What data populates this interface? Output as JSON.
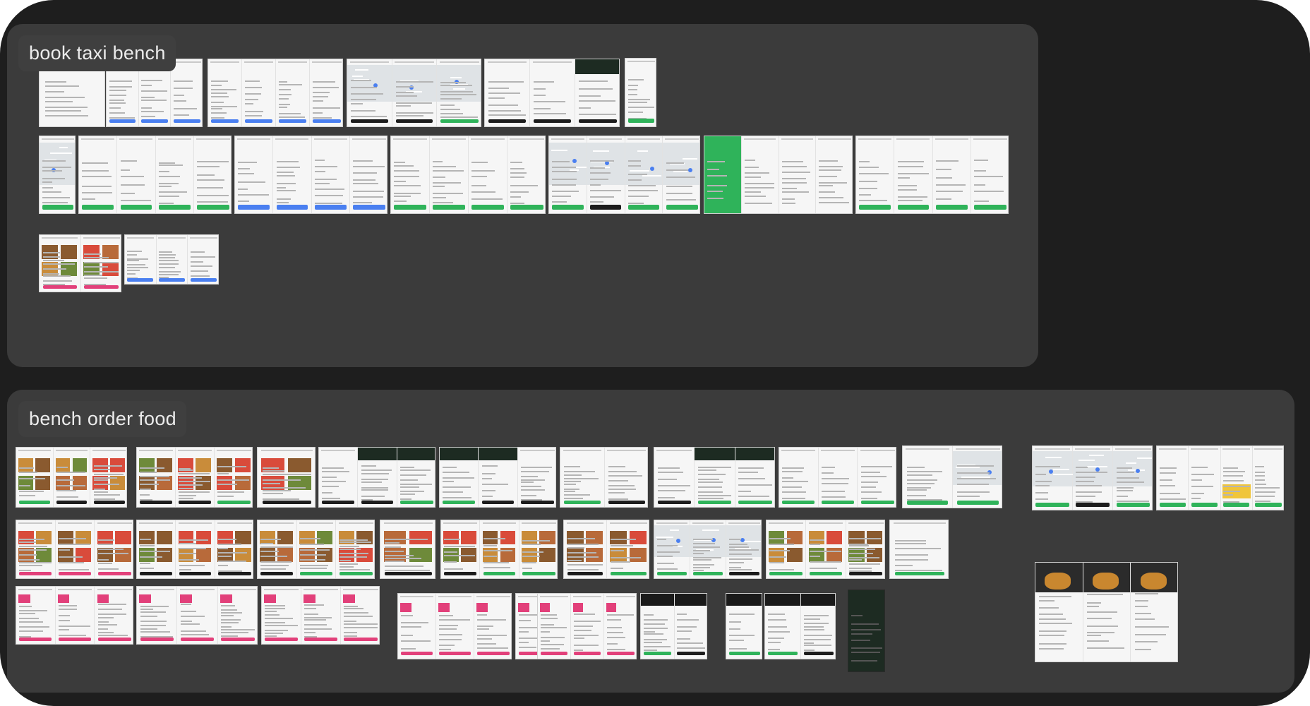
{
  "canvas": {
    "background": "#1e1e1e",
    "section_color": "#3b3b3b"
  },
  "sections": [
    {
      "id": "taxi",
      "label": "book taxi bench"
    },
    {
      "id": "food",
      "label": "bench order food"
    }
  ],
  "accent_colors": {
    "taxi_green": "#2fb35a",
    "food_red": "#d94b3b",
    "food_pink": "#e2407a",
    "map_blue": "#4a7ff0",
    "dark_green": "#1f3a2a",
    "gold": "#f0c53a"
  }
}
